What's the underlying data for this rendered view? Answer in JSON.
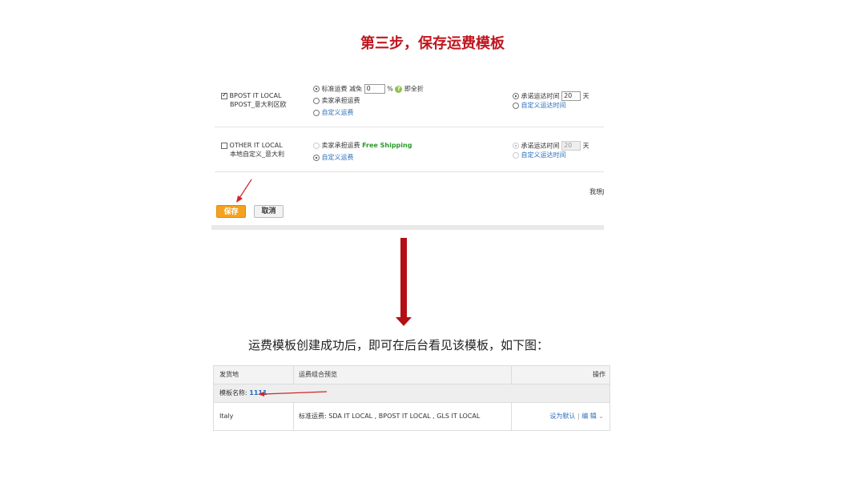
{
  "title": "第三步，保存运费模板",
  "panel": {
    "row1": {
      "checked": true,
      "name_en": "BPOST IT LOCAL",
      "name_cn": "BPOST_意大利区欧",
      "opt_standard": "标准运费 减免",
      "discount_value": "0",
      "percent": "%",
      "help_icon": "?",
      "full_discount": "即全折",
      "opt_seller": "卖家承担运费",
      "opt_custom": "自定义运费",
      "promise_label": "承诺运达时间",
      "promise_value": "20",
      "days": "天",
      "custom_time": "自定义运达时间"
    },
    "row2": {
      "checked": false,
      "name_en": "OTHER IT LOCAL",
      "name_cn": "本地自定义_意大利",
      "opt_seller": "卖家承担运费",
      "free_shipping": "Free Shipping",
      "opt_custom": "自定义运费",
      "promise_label": "承诺运达时间",
      "promise_value": "20",
      "days": "天",
      "custom_time": "自定义运达时间"
    },
    "side_text": "我想J",
    "save_label": "保存",
    "cancel_label": "取消"
  },
  "caption": "运费模板创建成功后，即可在后台看见该模板，如下图：",
  "table": {
    "headers": [
      "发货地",
      "运费组合预览",
      "操作"
    ],
    "template_label": "模板名称:",
    "template_name": "1111",
    "row": {
      "origin": "Italy",
      "preview": "标准运费: SDA IT LOCAL , BPOST IT LOCAL , GLS IT LOCAL",
      "set_default": "设为默认",
      "separator": "|",
      "edit": "编 辑"
    }
  },
  "colors": {
    "title_red": "#c0161f",
    "save_orange": "#f4a21f",
    "link_blue": "#2a6ebb",
    "arrow_red": "#b40f14"
  }
}
